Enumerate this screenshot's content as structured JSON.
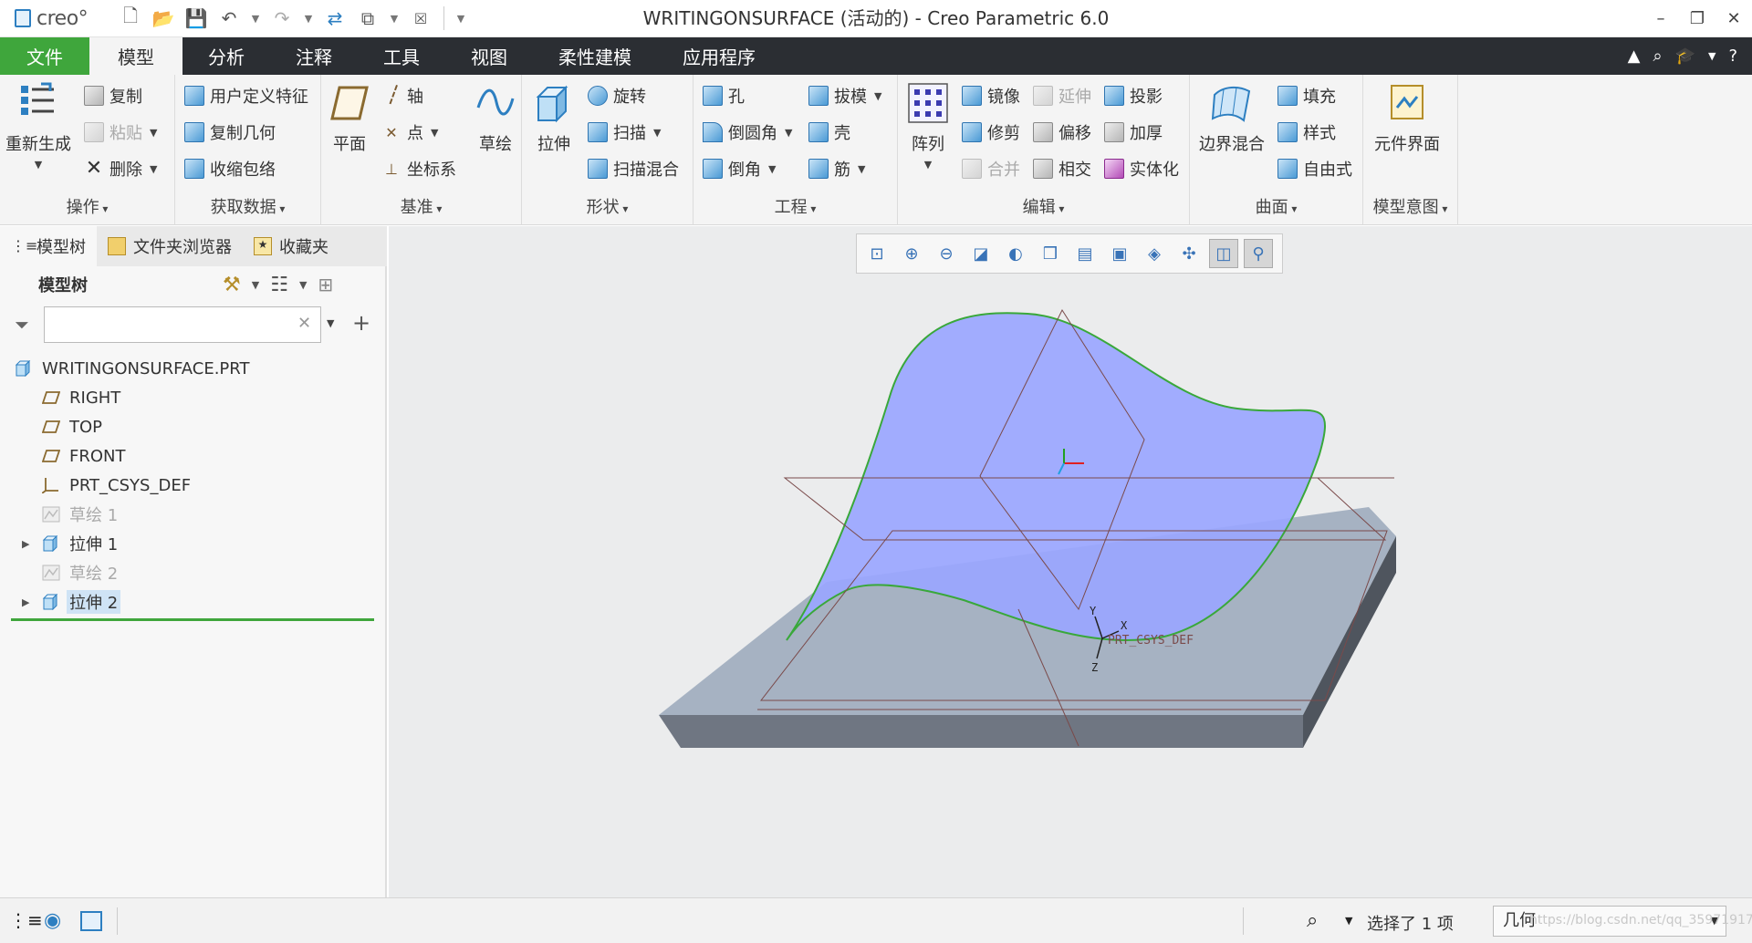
{
  "app": {
    "logo": "creo°",
    "title": "WRITINGONSURFACE (活动的) - Creo Parametric 6.0"
  },
  "menu": {
    "tabs": [
      "文件",
      "模型",
      "分析",
      "注释",
      "工具",
      "视图",
      "柔性建模",
      "应用程序"
    ],
    "active": "模型"
  },
  "ribbon": {
    "ops": {
      "regen": "重新生成",
      "copy": "复制",
      "paste": "粘贴",
      "delete": "删除",
      "label": "操作"
    },
    "getdata": {
      "udf": "用户定义特征",
      "copygeom": "复制几何",
      "shrinkwrap": "收缩包络",
      "label": "获取数据"
    },
    "datum": {
      "plane": "平面",
      "axis": "轴",
      "point": "点",
      "csys": "坐标系",
      "sketch": "草绘",
      "label": "基准"
    },
    "shapes": {
      "extrude": "拉伸",
      "revolve": "旋转",
      "sweep": "扫描",
      "sweptblend": "扫描混合",
      "label": "形状"
    },
    "engineering": {
      "hole": "孔",
      "round": "倒圆角",
      "chamfer": "倒角",
      "draft": "拔模",
      "shell": "壳",
      "rib": "筋",
      "label": "工程"
    },
    "editing": {
      "pattern": "阵列",
      "mirror": "镜像",
      "trim": "修剪",
      "merge": "合并",
      "extend": "延伸",
      "offset": "偏移",
      "intersect": "相交",
      "project": "投影",
      "thicken": "加厚",
      "solidify": "实体化",
      "label": "编辑"
    },
    "surfaces": {
      "boundary": "边界混合",
      "fill": "填充",
      "style": "样式",
      "freestyle": "自由式",
      "label": "曲面"
    },
    "intent": {
      "compinterface": "元件界面",
      "label": "模型意图"
    }
  },
  "leftTabs": [
    "模型树",
    "文件夹浏览器",
    "收藏夹"
  ],
  "modelTree": {
    "title": "模型树",
    "search": {
      "value": "",
      "placeholder": ""
    },
    "nodes": [
      {
        "label": "WRITINGONSURFACE.PRT",
        "kind": "part"
      },
      {
        "label": "RIGHT",
        "kind": "plane"
      },
      {
        "label": "TOP",
        "kind": "plane"
      },
      {
        "label": "FRONT",
        "kind": "plane"
      },
      {
        "label": "PRT_CSYS_DEF",
        "kind": "csys"
      },
      {
        "label": "草绘 1",
        "kind": "sketch"
      },
      {
        "label": "拉伸 1",
        "kind": "extrude"
      },
      {
        "label": "草绘 2",
        "kind": "sketch"
      },
      {
        "label": "拉伸 2",
        "kind": "extrude"
      }
    ]
  },
  "viewport": {
    "csys_label": "PRT_CSYS_DEF",
    "axis_x": "X",
    "axis_y": "Y",
    "axis_z": "Z",
    "colors": {
      "surface": "#9aa6ff",
      "block": "#a8b3c2",
      "edge": "#39a83a",
      "datum": "#7a4a4a"
    }
  },
  "status": {
    "selected": "选择了 1 项",
    "filter": "几何",
    "watermark": "https://blog.csdn.net/qq_35971917"
  }
}
